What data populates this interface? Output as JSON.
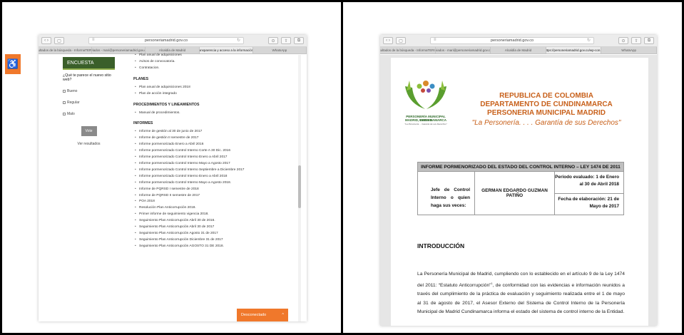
{
  "left": {
    "url": "personeriamadrid.gov.co",
    "tabs": [
      "Resultados de la búsqueda - InformaTERIO...",
      "Enviados - mari@personeriamadrid.gov.co...",
      "Alcaldía de Madrid",
      "Transparencia y acceso a la información...",
      "WhatsApp"
    ],
    "active_tab": 3,
    "survey": {
      "title": "ENCUESTA",
      "question": "¿Qué te parece el nuevo sitio web?",
      "options": [
        "Bueno",
        "Regular",
        "Malo"
      ],
      "vote_label": "Vote",
      "results_label": "Ver resultados"
    },
    "top_items": [
      "Plan anual de adquisiciones",
      "Avisos de convocatoria.",
      "Contratacion."
    ],
    "sections": [
      {
        "title": "PLANES",
        "items": [
          "Plan anual de adquisiciones 2018",
          "Plan de acción integrado"
        ]
      },
      {
        "title": "PROCEDIMIENTOS Y LINEAMIENTOS",
        "items": [
          "Manual de procedimientos."
        ]
      },
      {
        "title": "INFORMES",
        "items": [
          "Informe de gestión al 30 de junio de 2017",
          "Informe de gestión II semestre de 2017",
          "Informe pormenorizado Enero a Abril 2016",
          "Informe pormenorizado Control Interno Corte A 30 Dic. 2016",
          "Informe pormenorizado Control Interno Enero a Abril 2017",
          "Informe pormenorizado Control Interno Mayo a Agosto 2017",
          "Informe pormenorizado Control Interno Septiembre a Diciembre 2017",
          "Informe pormenorizado Control Interno Enero a Abril 2018",
          "Informe pormenorizado Control Interno Mayo a Agosto 2018.",
          "Informe de PQRSD I semestre de 2018",
          "Informe de PQRSD II semestre de 2017",
          "POA 2018",
          "Resolución Plan Anticorrupción 2018.",
          "Primer informe de seguimiento vigencia 2018.",
          "Seguimiento Plan Anticorrupción Abril 30 de 2016.",
          "Seguimiento Plan Anticorrupción Abril 30 de 2017",
          "Seguimiento Plan Anticorrupción Agosto 31 de 2017",
          "Seguimiento Plan Anticorrupción Diciembre 31 de 2017",
          "Seguimiento Plan Anticorrupción AGOSTO 31 DE 2018."
        ]
      }
    ],
    "chat_label": "Desconectado",
    "chat_chevron": "^",
    "icons": {
      "accessibility": "accessibility-icon"
    },
    "colors": {
      "accent": "#f0782b",
      "survey_header": "#3a5f2a"
    }
  },
  "right": {
    "url": "personeriamadrid.gov.co",
    "tabs": [
      "Resultados de la búsqueda - InformaTERIO...",
      "Enviados - mari@personeriamadrid.gov.co...",
      "Alcaldía de Madrid",
      "https://personeriamadrid.gov.co/wp-con...",
      "WhatsApp"
    ],
    "active_tab": 3,
    "logo_text_1": "PERSONERÍA MUNICIPAL MADRID",
    "logo_text_2": "MADRID, CUNDINAMARCA",
    "logo_sub": "\"La Personería ... Garante de sus Derechos\"",
    "heading_lines": [
      "REPUBLICA DE COLOMBIA",
      "DEPARTAMENTO DE CUNDINAMARCA",
      "PERSONERIA MUNICIPAL MADRID"
    ],
    "motto": "\"La Personería. . . . Garantía de sus Derechos\"",
    "report": {
      "title": "INFORME PORMENORIZADO DEL ESTADO DEL CONTROL INTERNO – LEY 1474 DE 2011",
      "label": "Jefe de Control Interno o quien haga sus veces:",
      "name": "GERMAN EDGARDO GUZMAN PATIÑO",
      "period": "Periodo evaluado: 1 de Enero al 30 de Abril 2018",
      "date": "Fecha de elaboración: 21 de Mayo de 2017"
    },
    "intro_heading": "INTRODUCCIÓN",
    "intro_text_a": "La Personería Municipal de Madrid, cumpliendo con lo establecido en el artículo 9 de la Ley 1474 del 2011: “Estatuto Anticorrupción”",
    "intro_sup": "1",
    "intro_text_b": ", de conformidad con las evidencias e información reunidos a través del cumplimiento de la práctica de evaluación y seguimiento realizada entre el 1 de mayo al 31 de agosto de 2017, el Asesor Externo del Sistema de Control Interno de la Personería Municipal de Madrid Cundinamarca informa el estado del sistema de control interno de la Entidad.",
    "colors": {
      "heading": "#c8601a",
      "logo_green": "#2f6b2a"
    }
  }
}
